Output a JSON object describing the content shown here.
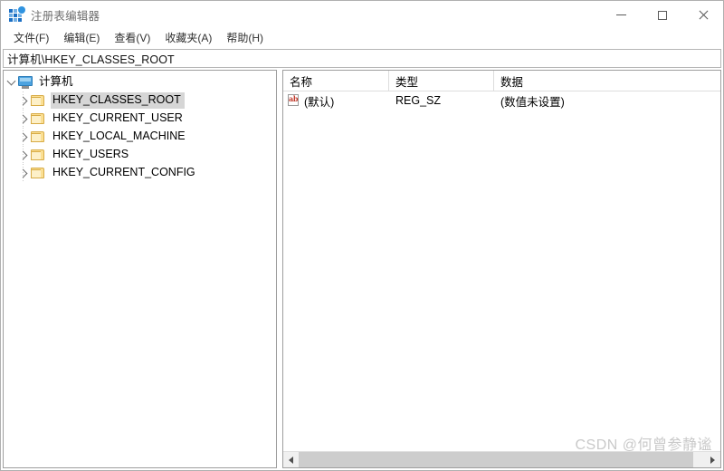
{
  "window": {
    "title": "注册表编辑器",
    "icon": "registry-editor-icon",
    "controls": {
      "minimize": "—",
      "maximize": "□",
      "close": "✕"
    }
  },
  "menubar": {
    "items": [
      {
        "label": "文件(F)"
      },
      {
        "label": "编辑(E)"
      },
      {
        "label": "查看(V)"
      },
      {
        "label": "收藏夹(A)"
      },
      {
        "label": "帮助(H)"
      }
    ]
  },
  "address": {
    "value": "计算机\\HKEY_CLASSES_ROOT",
    "placeholder": "计算机\\"
  },
  "tree": {
    "root": {
      "label": "计算机",
      "icon": "computer-monitor-icon",
      "expanded": true,
      "twisty": "chevron-down-icon"
    },
    "items": [
      {
        "label": "HKEY_CLASSES_ROOT",
        "icon": "folder-icon",
        "twisty": "chevron-right-icon",
        "selected": true
      },
      {
        "label": "HKEY_CURRENT_USER",
        "icon": "folder-icon",
        "twisty": "chevron-right-icon",
        "selected": false
      },
      {
        "label": "HKEY_LOCAL_MACHINE",
        "icon": "folder-icon",
        "twisty": "chevron-right-icon",
        "selected": false
      },
      {
        "label": "HKEY_USERS",
        "icon": "folder-icon",
        "twisty": "chevron-right-icon",
        "selected": false
      },
      {
        "label": "HKEY_CURRENT_CONFIG",
        "icon": "folder-icon",
        "twisty": "chevron-right-icon",
        "selected": false
      }
    ]
  },
  "list": {
    "columns": [
      {
        "label": "名称"
      },
      {
        "label": "类型"
      },
      {
        "label": "数据"
      }
    ],
    "rows": [
      {
        "icon": "string-value-ab-icon",
        "icon_text": "ab",
        "name": "(默认)",
        "type": "REG_SZ",
        "data": "(数值未设置)"
      }
    ]
  },
  "scrollbar": {
    "left_arrow": "scroll-left-arrow",
    "right_arrow": "scroll-right-arrow"
  },
  "watermark": {
    "text": "CSDN @何曾参静谧"
  },
  "colors": {
    "selection": "#d6d6d6",
    "folder": "#fbdf93",
    "accent": "#1b6fc4",
    "string_icon": "#c0392b",
    "watermark": "#c9c9c9"
  }
}
